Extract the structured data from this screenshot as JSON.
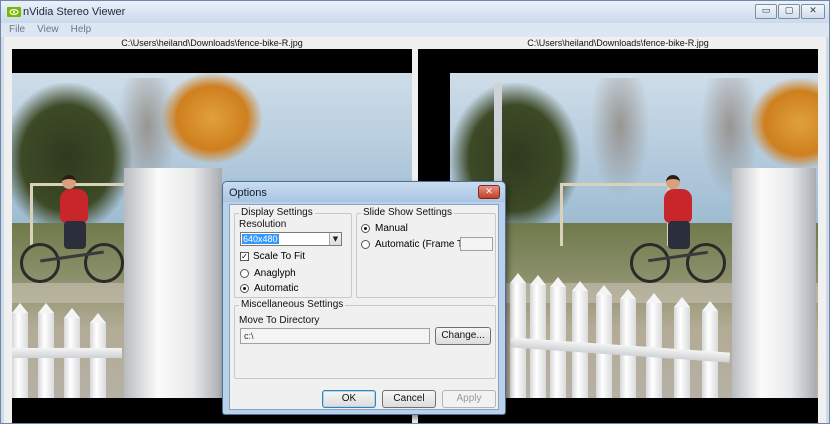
{
  "window": {
    "title": "nVidia Stereo Viewer",
    "controls": {
      "minimize": "▭",
      "maximize": "▢",
      "close": "✕"
    }
  },
  "menu": {
    "items": [
      "File",
      "View",
      "Help"
    ]
  },
  "panes": {
    "left_caption": "C:\\Users\\heiland\\Downloads\\fence-bike-R.jpg",
    "right_caption": "C:\\Users\\heiland\\Downloads\\fence-bike-R.jpg"
  },
  "dialog": {
    "title": "Options",
    "close_glyph": "✕",
    "display_settings": {
      "group_label": "Display Settings",
      "resolution_label": "Resolution",
      "resolution_value": "640x480",
      "scale_to_fit_label": "Scale To Fit",
      "scale_to_fit_checked": true,
      "anaglyph_label": "Anaglyph",
      "automatic_label": "Automatic",
      "selected_mode": "Automatic"
    },
    "slideshow": {
      "group_label": "Slide Show Settings",
      "manual_label": "Manual",
      "automatic_label": "Automatic (Frame Time)",
      "selected": "Manual",
      "frame_time_value": ""
    },
    "misc": {
      "group_label": "Miscellaneous Settings",
      "move_to_label": "Move To Directory",
      "directory_value": "c:\\",
      "change_button": "Change..."
    },
    "buttons": {
      "ok": "OK",
      "cancel": "Cancel",
      "apply": "Apply"
    }
  }
}
